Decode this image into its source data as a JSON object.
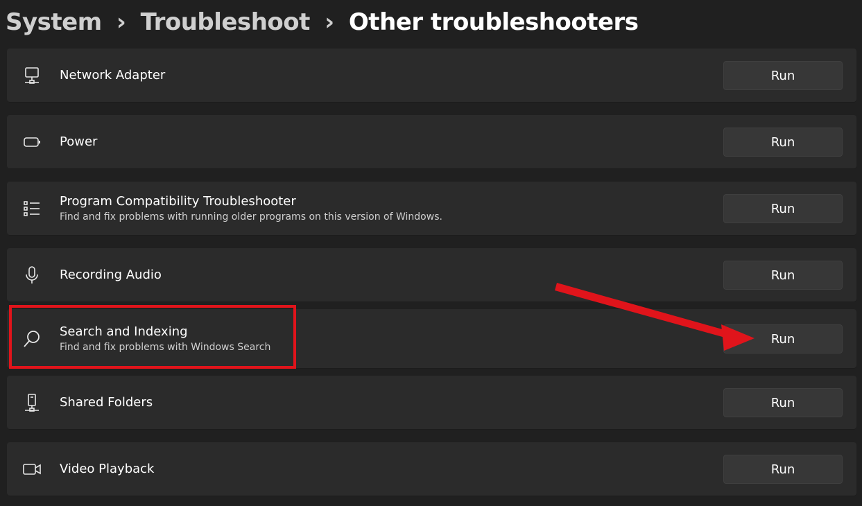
{
  "breadcrumb": {
    "items": [
      "System",
      "Troubleshoot",
      "Other troubleshooters"
    ],
    "separator": "›"
  },
  "troubleshooters": [
    {
      "title": "Network Adapter",
      "description": "",
      "icon": "network-adapter-icon",
      "button": "Run"
    },
    {
      "title": "Power",
      "description": "",
      "icon": "battery-icon",
      "button": "Run"
    },
    {
      "title": "Program Compatibility Troubleshooter",
      "description": "Find and fix problems with running older programs on this version of Windows.",
      "icon": "list-icon",
      "button": "Run"
    },
    {
      "title": "Recording Audio",
      "description": "",
      "icon": "microphone-icon",
      "button": "Run"
    },
    {
      "title": "Search and Indexing",
      "description": "Find and fix problems with Windows Search",
      "icon": "search-icon",
      "button": "Run"
    },
    {
      "title": "Shared Folders",
      "description": "",
      "icon": "shared-folder-icon",
      "button": "Run"
    },
    {
      "title": "Video Playback",
      "description": "",
      "icon": "video-camera-icon",
      "button": "Run"
    }
  ],
  "colors": {
    "background": "#202020",
    "card": "#2b2b2b",
    "button": "#373737",
    "highlight": "#e0141b"
  }
}
